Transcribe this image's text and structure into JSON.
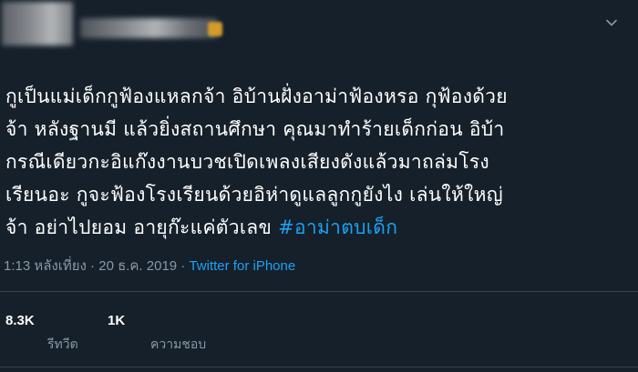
{
  "tweet": {
    "lines": [
      "กูเป็นแม่เด็กกูฟ้องแหลกจ้า อิบ้านฝั่งอาม่าฟ้องหรอ กุฟ้องด้วย",
      "จ้า หลังฐานมี แล้วยิ่งสถานศึกษา คุณมาทำร้ายเด็กก่อน อิบ้า",
      "กรณีเดียวกะอิแก๊งงานบวชเปิดเพลงเสียงดังแล้วมาถล่มโรง",
      "เรียนอะ กูจะฟ้องโรงเรียนด้วยอิห่าดูแลลูกกูยังไง เล่นให้ใหญ่",
      "จ้า อย่าไปยอม อายุก๊ะแค่ตัวเลข "
    ],
    "hashtag": "#อาม่าตบเด็ก",
    "time": "1:13 หลังเที่ยง · 20 ธ.ค. 2019 · ",
    "source": "Twitter for iPhone"
  },
  "stats": {
    "retweets_count": "8.3K",
    "retweets_label": "รีทวีต",
    "likes_count": "1K",
    "likes_label": "ความชอบ"
  },
  "colors": {
    "background": "#15202b",
    "link": "#1da1f2",
    "muted": "#8899a6",
    "divider": "#38444d"
  },
  "icons": {
    "menu": "chevron-down-icon"
  }
}
